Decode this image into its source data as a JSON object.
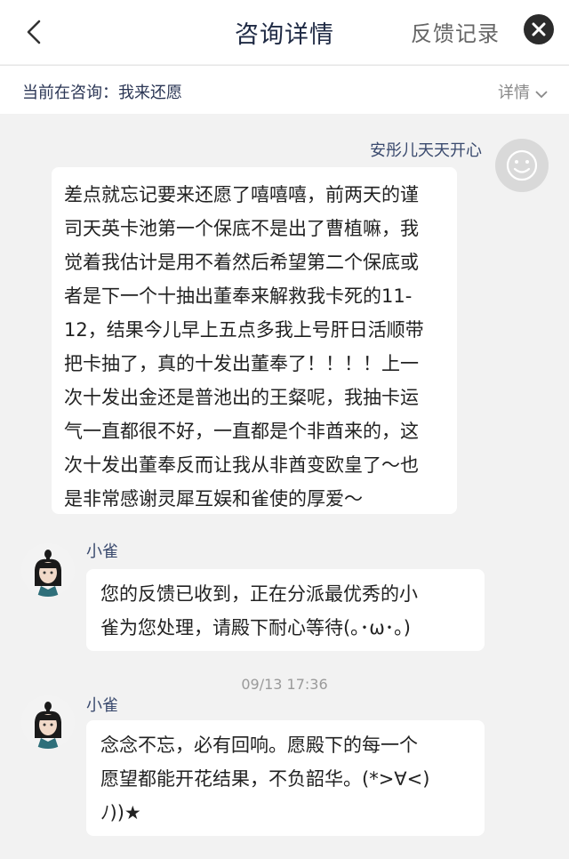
{
  "header": {
    "title": "咨询详情",
    "feedback_label": "反馈记录",
    "back_icon": "chevron-left-icon",
    "close_icon": "close-icon"
  },
  "subbar": {
    "current_label": "当前在咨询：我来还愿",
    "details_label": "详情"
  },
  "messages": [
    {
      "sender": "安彤儿天天开心",
      "lines": [
        "差点就忘记要来还愿了嘻嘻嘻，前两天的谨",
        "司天英卡池第一个保底不是出了曹植嘛，我",
        "觉着我估计是用不着然后希望第二个保底或",
        "者是下一个十抽出董奉来解救我卡死的11-",
        "12，结果今儿早上五点多我上号肝日活顺带",
        "把卡抽了，真的十发出董奉了！！！！上一",
        "次十发出金还是普池出的王粲呢，我抽卡运",
        "气一直都很不好，一直都是个非酋来的，这",
        "次十发出董奉反而让我从非酋变欧皇了～也",
        "是非常感谢灵犀互娱和雀使的厚爱～"
      ]
    },
    {
      "sender": "小雀",
      "lines": [
        "您的反馈已收到，正在分派最优秀的小",
        "雀为您处理，请殿下耐心等待(｡･ω･｡)"
      ]
    },
    {
      "timestamp": "09/13 17:36"
    },
    {
      "sender": "小雀",
      "lines": [
        "念念不忘，必有回响。愿殿下的每一个",
        "愿望都能开花结果，不负韶华。(*>∀<)",
        "ﾉ))★"
      ]
    }
  ],
  "colors": {
    "background": "#f2f2f2",
    "bubble": "#ffffff",
    "name_text": "#3a4a6e",
    "title_text": "#1f2a44"
  }
}
